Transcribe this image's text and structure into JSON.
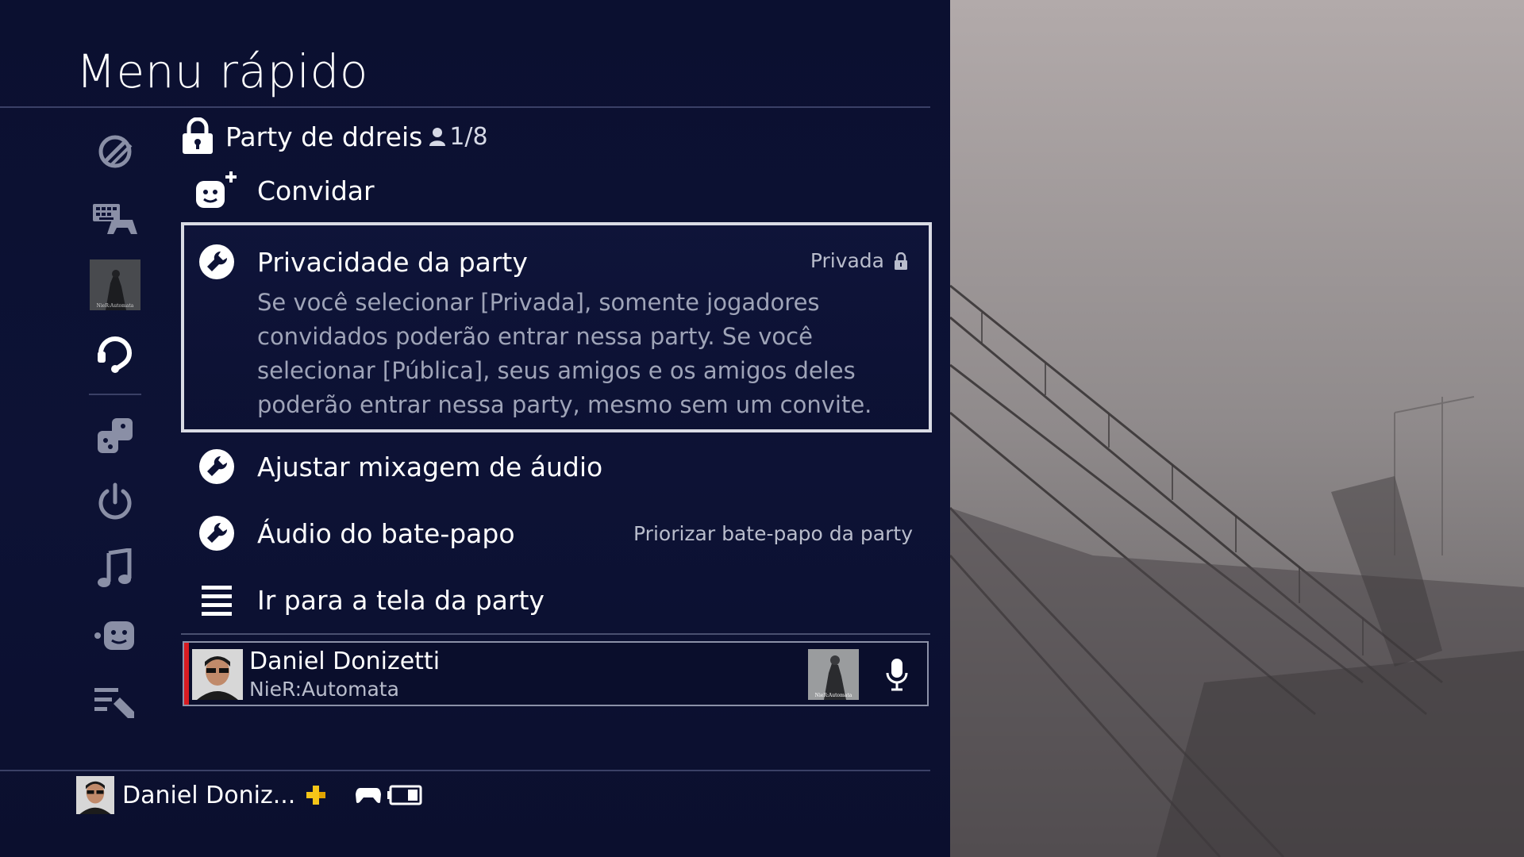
{
  "header": {
    "title": "Menu rápido"
  },
  "sidebar": {
    "items": [
      {
        "icon": "do-not-disturb-icon"
      },
      {
        "icon": "keyboard-controller-icon"
      },
      {
        "icon": "game-thumbnail-icon"
      },
      {
        "icon": "headset-icon",
        "selected": true
      },
      {
        "icon": "puzzle-icon"
      },
      {
        "icon": "power-icon"
      },
      {
        "icon": "music-note-icon"
      },
      {
        "icon": "friend-face-icon"
      },
      {
        "icon": "customize-list-icon"
      }
    ]
  },
  "party": {
    "name": "Party de ddreis",
    "count": "1/8",
    "invite_label": "Convidar",
    "privacy": {
      "label": "Privacidade da party",
      "value": "Privada",
      "description": "Se você selecionar [Privada], somente jogadores convidados poderão entrar nessa party. Se você selecionar [Pública], seus amigos e os amigos deles poderão entrar nessa party, mesmo sem um convite."
    },
    "audio_mix_label": "Ajustar mixagem de áudio",
    "chat_audio": {
      "label": "Áudio do bate-papo",
      "value": "Priorizar bate-papo da party"
    },
    "go_to_party_label": "Ir para a tela da party",
    "member": {
      "name": "Daniel Donizetti",
      "game": "NieR:Automata"
    }
  },
  "footer": {
    "user_name": "Daniel Doniz..."
  },
  "colors": {
    "background": "#0c1030",
    "accent_red": "#d81c22",
    "plus_yellow": "#f5c518"
  }
}
